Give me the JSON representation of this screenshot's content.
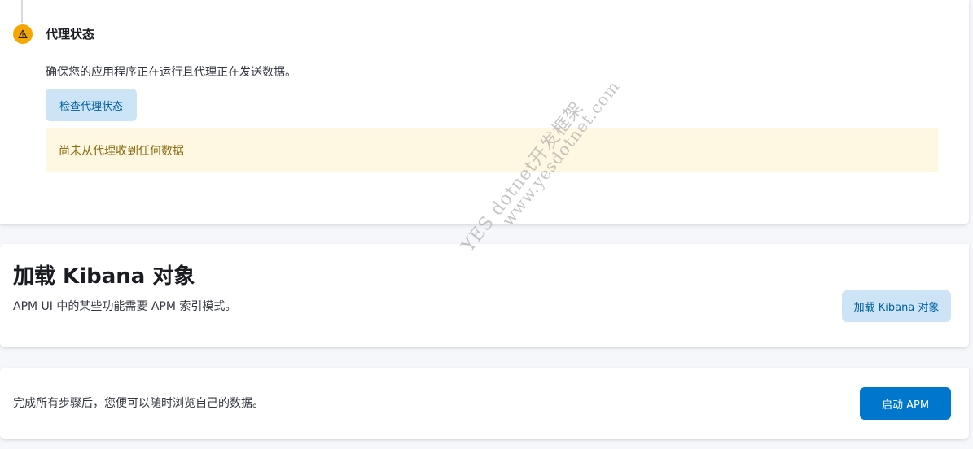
{
  "agent_status": {
    "title": "代理状态",
    "description": "确保您的应用程序正在运行且代理正在发送数据。",
    "check_button_label": "检查代理状态",
    "callout_text": "尚未从代理收到任何数据",
    "icon": "warning-icon"
  },
  "kibana_objects": {
    "title": "加载 Kibana 对象",
    "description": "APM UI 中的某些功能需要 APM 索引模式。",
    "button_label": "加载 Kibana 对象"
  },
  "launch": {
    "description": "完成所有步骤后，您便可以随时浏览自己的数据。",
    "button_label": "启动 APM"
  },
  "watermark": {
    "line1": "YES dotnet开发框架",
    "line2": "www.yesdotnet.com"
  },
  "colors": {
    "warning": "#f5a700",
    "primary": "#0077cc",
    "callout_bg": "#fef7e2",
    "light_button_bg": "#cce4f5"
  }
}
